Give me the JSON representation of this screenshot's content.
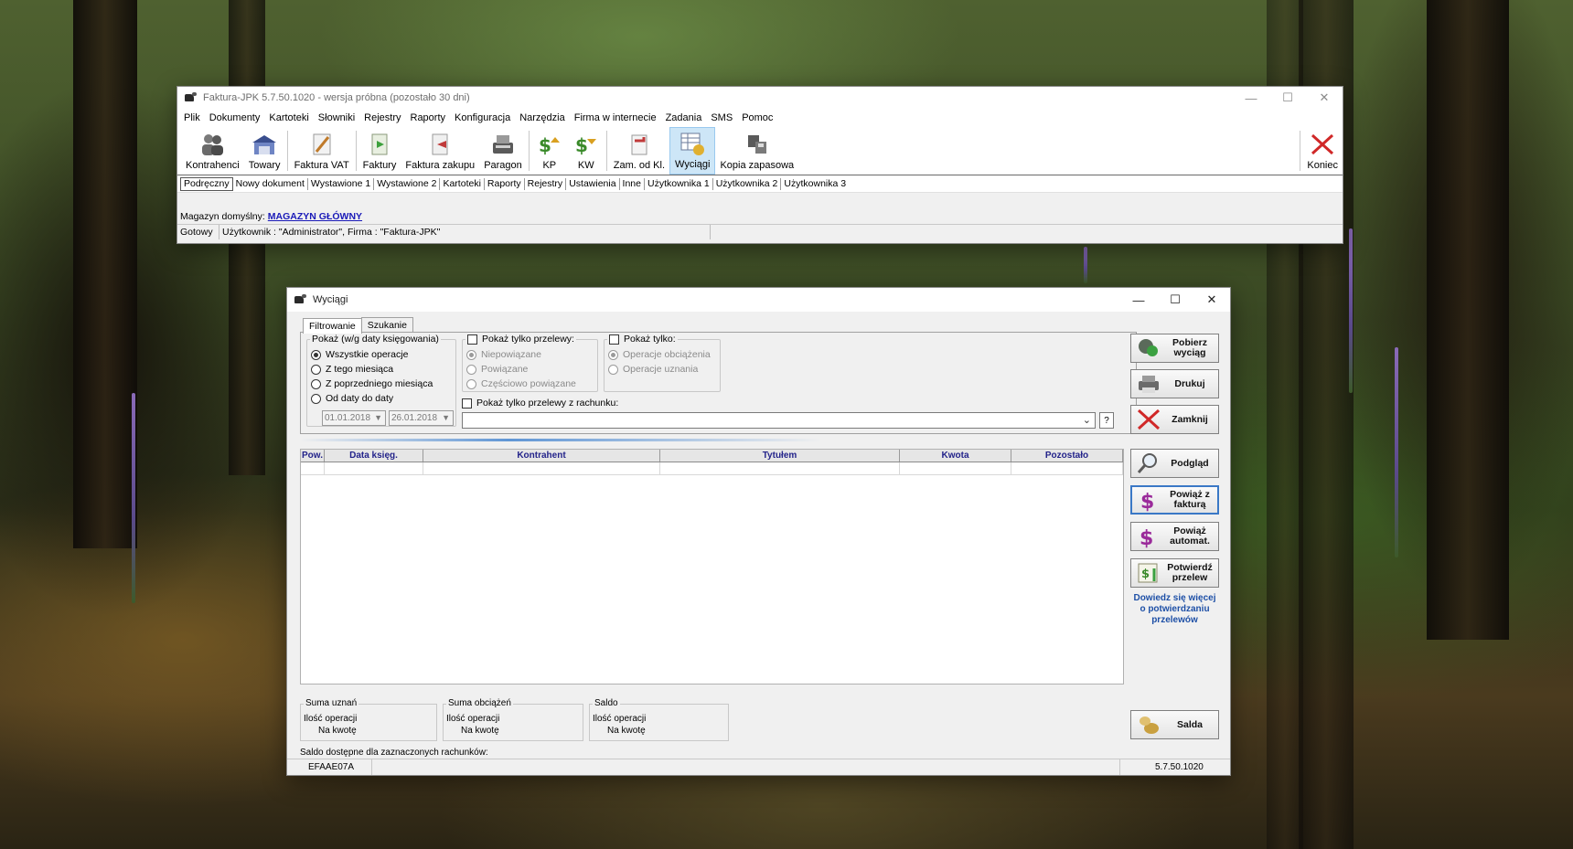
{
  "main_window": {
    "title": "Faktura-JPK 5.7.50.1020 - wersja próbna (pozostało 30 dni)",
    "menu": [
      "Plik",
      "Dokumenty",
      "Kartoteki",
      "Słowniki",
      "Rejestry",
      "Raporty",
      "Konfiguracja",
      "Narzędzia",
      "Firma w internecie",
      "Zadania",
      "SMS",
      "Pomoc"
    ],
    "toolbar": {
      "kontrahenci": "Kontrahenci",
      "towary": "Towary",
      "faktura_vat": "Faktura VAT",
      "faktury": "Faktury",
      "faktura_zakupu": "Faktura zakupu",
      "paragon": "Paragon",
      "kp": "KP",
      "kw": "KW",
      "zam_od_kl": "Zam. od Kl.",
      "wyciagi": "Wyciągi",
      "kopia": "Kopia zapasowa",
      "koniec": "Koniec"
    },
    "quick_tabs": [
      "Podręczny",
      "Nowy dokument",
      "Wystawione 1",
      "Wystawione 2",
      "Kartoteki",
      "Raporty",
      "Rejestry",
      "Ustawienia",
      "Inne",
      "Użytkownika 1",
      "Użytkownika 2",
      "Użytkownika 3"
    ],
    "magazyn_label": "Magazyn domyślny:",
    "magazyn_value": "MAGAZYN GŁÓWNY",
    "status_ready": "Gotowy",
    "status_user": "Użytkownik : \"Administrator\", Firma : \"Faktura-JPK\""
  },
  "wyciagi_window": {
    "title": "Wyciągi",
    "tabs": [
      "Filtrowanie",
      "Szukanie"
    ],
    "show_group": {
      "label": "Pokaż (w/g daty księgowania)",
      "options": [
        "Wszystkie operacje",
        "Z tego miesiąca",
        "Z poprzedniego miesiąca",
        "Od daty do daty"
      ],
      "date_from": "01.01.2018",
      "date_to": "26.01.2018"
    },
    "transfers_group": {
      "label": "Pokaż tylko przelewy:",
      "options": [
        "Niepowiązane",
        "Powiązane",
        "Częściowo powiązane"
      ]
    },
    "only_group": {
      "label": "Pokaż tylko:",
      "options": [
        "Operacje obciążenia",
        "Operacje uznania"
      ]
    },
    "account_filter_label": "Pokaż tylko przelewy z rachunku:",
    "account_value": "",
    "help_button": "?",
    "columns": [
      "Pow.",
      "Data księg.",
      "Kontrahent",
      "Tytułem",
      "Kwota",
      "Pozostało"
    ],
    "buttons": {
      "pobierz": "Pobierz wyciąg",
      "drukuj": "Drukuj",
      "zamknij": "Zamknij",
      "podglad": "Podgląd",
      "powiaz_z_faktura": "Powiąż z fakturą",
      "powiaz_automat": "Powiąż automat.",
      "potwierdz": "Potwierdź przelew",
      "saldo": "Salda"
    },
    "learn_more": "Dowiedz się więcej o potwierdzaniu przelewów",
    "summaries": {
      "uznan": {
        "label": "Suma uznań",
        "count": "Ilość operacji",
        "amount": "Na kwotę"
      },
      "obciazen": {
        "label": "Suma obciążeń",
        "count": "Ilość operacji",
        "amount": "Na kwotę"
      },
      "saldo": {
        "label": "Saldo",
        "count": "Ilość operacji",
        "amount": "Na kwotę"
      }
    },
    "saldo_info": "Saldo dostępne dla zaznaczonych rachunków:",
    "status_code": "EFAAE07A",
    "status_version": "5.7.50.1020"
  }
}
